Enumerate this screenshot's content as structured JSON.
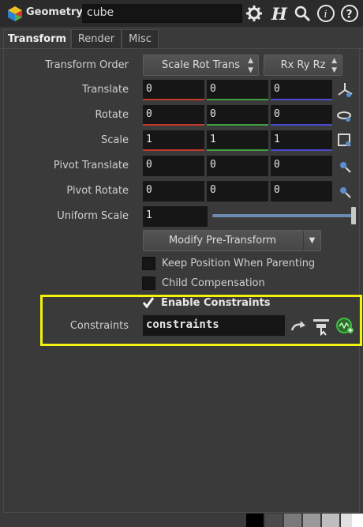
{
  "header": {
    "node_type": "Geometry",
    "node_name": "cube",
    "icons": [
      "node-type-icon",
      "gear-icon",
      "houdini-h-icon",
      "search-icon",
      "info-icon",
      "help-icon"
    ]
  },
  "tabs": [
    {
      "label": "Transform",
      "active": true
    },
    {
      "label": "Render",
      "active": false
    },
    {
      "label": "Misc",
      "active": false
    }
  ],
  "params": {
    "transform_order": {
      "label": "Transform Order",
      "order_menu": "Scale Rot Trans",
      "rot_menu": "Rx Ry Rz"
    },
    "translate": {
      "label": "Translate",
      "x": "0",
      "y": "0",
      "z": "0"
    },
    "rotate": {
      "label": "Rotate",
      "x": "0",
      "y": "0",
      "z": "0"
    },
    "scale": {
      "label": "Scale",
      "x": "1",
      "y": "1",
      "z": "1"
    },
    "pivot_translate": {
      "label": "Pivot Translate",
      "x": "0",
      "y": "0",
      "z": "0"
    },
    "pivot_rotate": {
      "label": "Pivot Rotate",
      "x": "0",
      "y": "0",
      "z": "0"
    },
    "uniform_scale": {
      "label": "Uniform Scale",
      "value": "1"
    },
    "pretransform_menu": "Modify Pre-Transform",
    "keep_position": {
      "label": "Keep Position When Parenting",
      "checked": false
    },
    "child_compensation": {
      "label": "Child Compensation",
      "checked": false
    },
    "enable_constraints": {
      "label": "Enable Constraints",
      "checked": true
    },
    "constraints": {
      "label": "Constraints",
      "value": "constraints"
    }
  },
  "colors": {
    "x_axis": "#c0392b",
    "y_axis": "#3fa03f",
    "z_axis": "#4a4ad0",
    "highlight": "#f2f20e"
  },
  "swatches": [
    "#000000",
    "#4a4a4a",
    "#7a7a7a",
    "#9a9a9a",
    "#bebebe",
    "#e0e0e0",
    "#ffffff"
  ]
}
